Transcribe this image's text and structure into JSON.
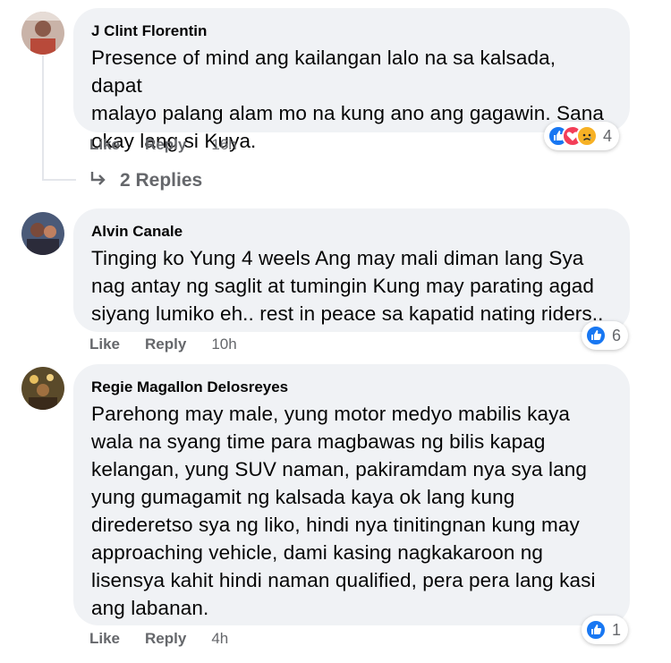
{
  "comments": [
    {
      "author": "J Clint Florentin",
      "text_lines": [
        "Presence of mind ang kailangan lalo na sa kalsada, dapat",
        "malayo palang alam mo na kung ano ang gagawin. Sana",
        "okay lang si Kuya."
      ],
      "like_label": "Like",
      "reply_label": "Reply",
      "time": "16h",
      "reaction_count": "4",
      "reaction_icons": [
        "like-icon",
        "love-icon",
        "sad-icon"
      ],
      "replies_label": "2 Replies"
    },
    {
      "author": "Alvin Canale",
      "text_lines": [
        "Tinging ko Yung 4 weels Ang may mali diman lang Sya",
        "nag antay ng saglit at tumingin Kung may parating agad",
        "siyang lumiko eh.. rest in peace sa kapatid nating riders.."
      ],
      "like_label": "Like",
      "reply_label": "Reply",
      "time": "10h",
      "reaction_count": "6",
      "reaction_icons": [
        "like-icon"
      ]
    },
    {
      "author": "Regie Magallon Delosreyes",
      "text_lines": [
        "Parehong may male, yung motor medyo mabilis kaya",
        "wala na syang time para magbawas ng bilis kapag",
        "kelangan, yung SUV naman, pakiramdam nya sya lang",
        "yung gumagamit ng kalsada kaya ok lang kung",
        "direderetso sya ng liko, hindi nya tinitingnan kung may",
        "approaching vehicle, dami kasing nagkakaroon ng",
        "lisensya kahit hindi naman qualified, pera pera lang kasi",
        "ang labanan."
      ],
      "like_label": "Like",
      "reply_label": "Reply",
      "time": "4h",
      "reaction_count": "1",
      "reaction_icons": [
        "like-icon"
      ]
    }
  ],
  "colors": {
    "bubble": "#f0f2f5",
    "like_blue": "#1877f2",
    "love_red": "#f33e58",
    "sad_yellow": "#f7b125",
    "secondary_text": "#65676b"
  }
}
